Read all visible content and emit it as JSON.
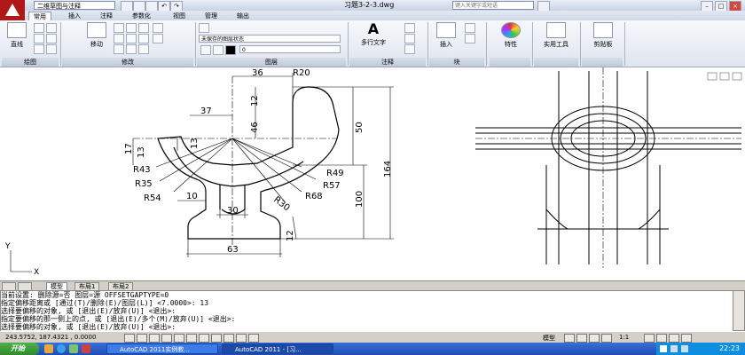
{
  "app": {
    "workspace": "二维草图与注释",
    "document_title": "习题3-2-3.dwg",
    "search_placeholder": "键入关键字或短语"
  },
  "ribbon_tabs": [
    "常用",
    "插入",
    "注释",
    "参数化",
    "视图",
    "管理",
    "输出"
  ],
  "ribbon": {
    "line_label": "直线",
    "move_label": "移动",
    "layer_state": "未保存的图层状态",
    "layer_current": "0",
    "mtext_label": "多行文字",
    "insert_label": "插入",
    "properties_label": "特性",
    "utilities_label": "实用工具",
    "clipboard_label": "剪贴板",
    "panels": {
      "draw": "绘图",
      "modify": "修改",
      "layers": "图层",
      "annotation": "注释",
      "block": "块"
    }
  },
  "drawing": {
    "dims": {
      "d36": "36",
      "r20": "R20",
      "d12a": "12",
      "d46": "46",
      "d50": "50",
      "d37": "37",
      "d13a": "13",
      "d17": "17",
      "d13b": "13",
      "r43": "R43",
      "r35": "R35",
      "r54": "R54",
      "d10": "10",
      "d30": "30",
      "r30": "R30",
      "r49": "R49",
      "r57": "R57",
      "r68": "R68",
      "d164": "164",
      "d100": "100",
      "d12b": "12",
      "d63": "63"
    },
    "ucs_x": "X",
    "ucs_y": "Y"
  },
  "layout_tabs": [
    "模型",
    "布局1",
    "布局2"
  ],
  "command_lines": [
    "当前设置:  删除源=否  图层=源  OFFSETGAPTYPE=0",
    "指定偏移距离或 [通过(T)/删除(E)/图层(L)] <7.0000>:  13",
    "选择要偏移的对象, 或 [退出(E)/放弃(U)] <退出>:",
    "指定要偏移的那一侧上的点, 或 [退出(E)/多个(M)/放弃(U)] <退出>:",
    "选择要偏移的对象, 或 [退出(E)/放弃(U)] <退出>:"
  ],
  "status": {
    "coordinates": "243.5752, 187.4321 , 0.0000",
    "model_label": "模型",
    "scale": "1:1"
  },
  "taskbar": {
    "start": "开始",
    "tasks": [
      "AutoCAD 2011实例教...",
      "AutoCAD 2011 - [习..."
    ],
    "clock": "22:23"
  },
  "colors": {
    "autocad_red": "#b01818",
    "taskbar_blue": "#1d4eb4",
    "start_green": "#3a9a36"
  }
}
